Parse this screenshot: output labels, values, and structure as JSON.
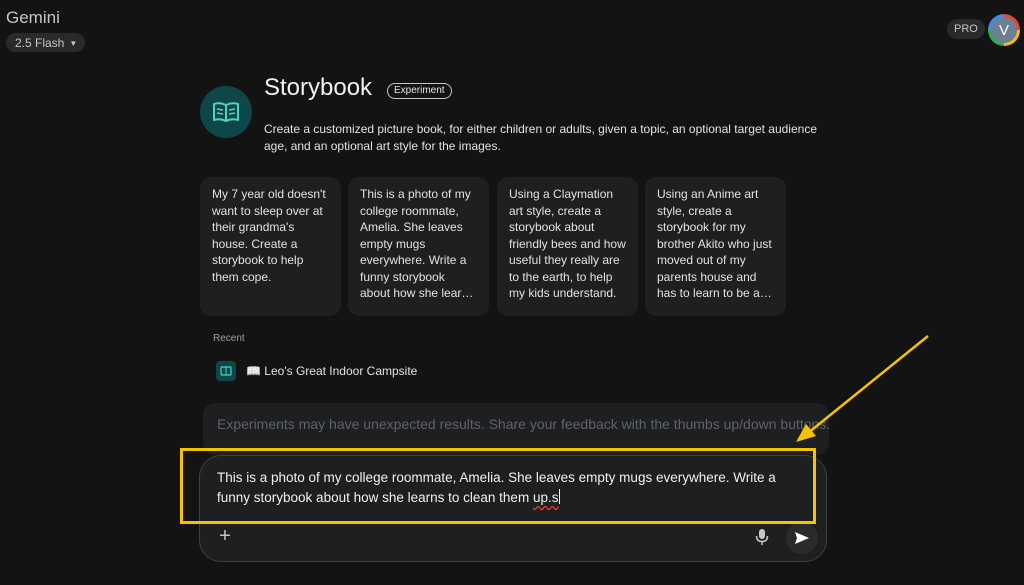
{
  "header": {
    "app_title": "Gemini",
    "model_label": "2.5 Flash",
    "pro_label": "PRO",
    "avatar_initial": "V"
  },
  "gem": {
    "icon": "book-icon",
    "title": "Storybook",
    "badge": "Experiment",
    "description": "Create a customized picture book, for either children or adults, given a topic, an optional target audience age, and an optional art style for the images."
  },
  "prompt_cards": [
    {
      "text": "My 7 year old doesn't want to sleep over at their grandma's house. Create a storybook to help them cope."
    },
    {
      "text": "This is a photo of my college roommate, Amelia. She leaves empty mugs everywhere. Write a funny storybook about how she learns to clean them up."
    },
    {
      "text": "Using a Claymation art style, create a storybook about friendly bees and how useful they really are to the earth, to help my kids understand."
    },
    {
      "text": "Using an Anime art style, create a storybook for my brother Akito who just moved out of my parents house and has to learn to be an adult."
    }
  ],
  "recent": {
    "label": "Recent",
    "items": [
      {
        "emoji": "📖",
        "title": "Leo's Great Indoor Campsite"
      }
    ]
  },
  "notice": {
    "text": "Experiments may have unexpected results. Share your feedback with the thumbs up/down buttons."
  },
  "input": {
    "text_main": "This is a photo of my college roommate, Amelia. She leaves empty mugs everywhere. Write a funny storybook about how she learns to clean them ",
    "text_misspelled": "up.s",
    "icons": {
      "add": "plus-icon",
      "mic": "microphone-icon",
      "send": "send-icon"
    }
  },
  "annotation": {
    "color": "#f5c400"
  },
  "colors": {
    "background": "#131314",
    "surface": "#1e1f20",
    "accent_teal": "#0f4748"
  }
}
